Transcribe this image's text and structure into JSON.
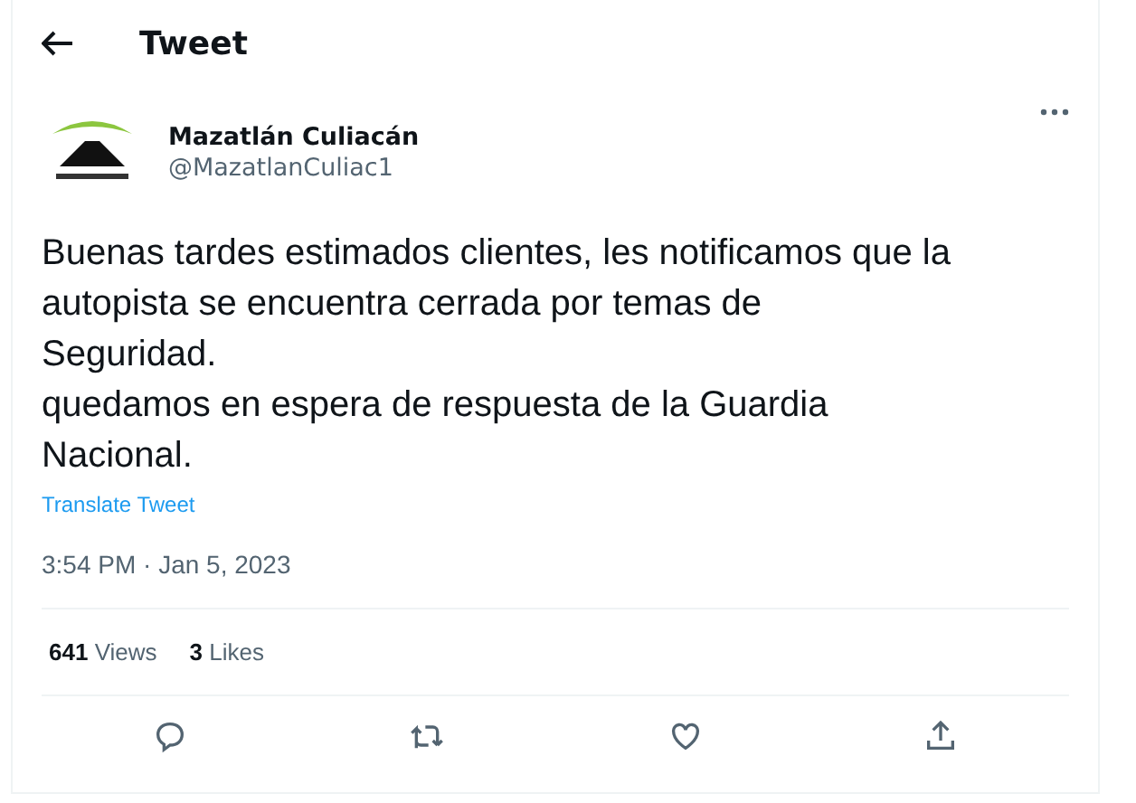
{
  "header": {
    "title": "Tweet"
  },
  "author": {
    "name": "Mazatlán Culiacán",
    "handle": "@MazatlanCuliac1"
  },
  "text_lines": [
    "Buenas tardes estimados clientes, les notificamos que la",
    "autopista se encuentra cerrada por temas de",
    "Seguridad.",
    "quedamos en espera de respuesta de la Guardia",
    "Nacional."
  ],
  "translate_link": "Translate Tweet",
  "timestamp": "3:54 PM · Jan 5, 2023",
  "stats": [
    {
      "count": "641",
      "label": "Views"
    },
    {
      "count": "3",
      "label": "Likes"
    }
  ],
  "actions": [
    {
      "kind": "reply"
    },
    {
      "kind": "retweet"
    },
    {
      "kind": "like"
    },
    {
      "kind": "share"
    }
  ]
}
